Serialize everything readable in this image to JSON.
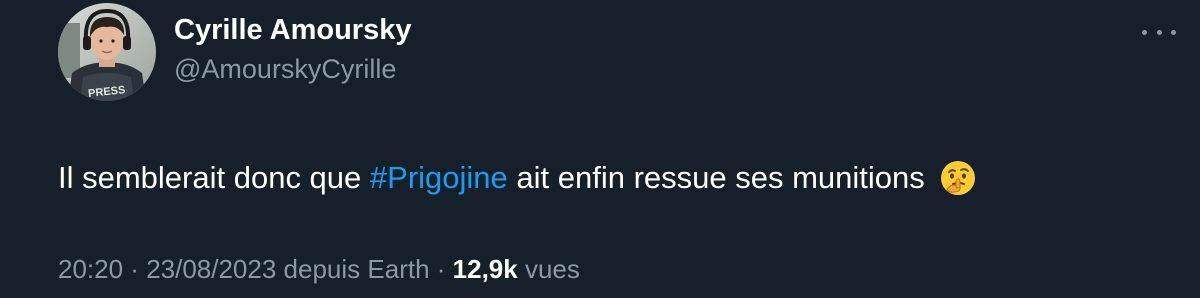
{
  "author": {
    "display_name": "Cyrille Amoursky",
    "handle": "@AmourskyCyrille",
    "avatar_vest_text": "PRESS"
  },
  "menu": {
    "icon": "more-horizontal-icon"
  },
  "tweet": {
    "text_before": "Il semblerait donc que ",
    "hashtag": "#Prigojine",
    "text_after": " ait enfin ressue ses munitions",
    "emoji": "thinking-face-icon"
  },
  "meta": {
    "time": "20:20",
    "separator1": " · ",
    "date": "23/08/2023",
    "source": " depuis Earth",
    "separator2": " · ",
    "views_count": "12,9k",
    "views_label": " vues"
  },
  "colors": {
    "background": "#15202b",
    "text": "#ffffff",
    "secondary": "#8b98a5",
    "link": "#1d9bf0"
  }
}
